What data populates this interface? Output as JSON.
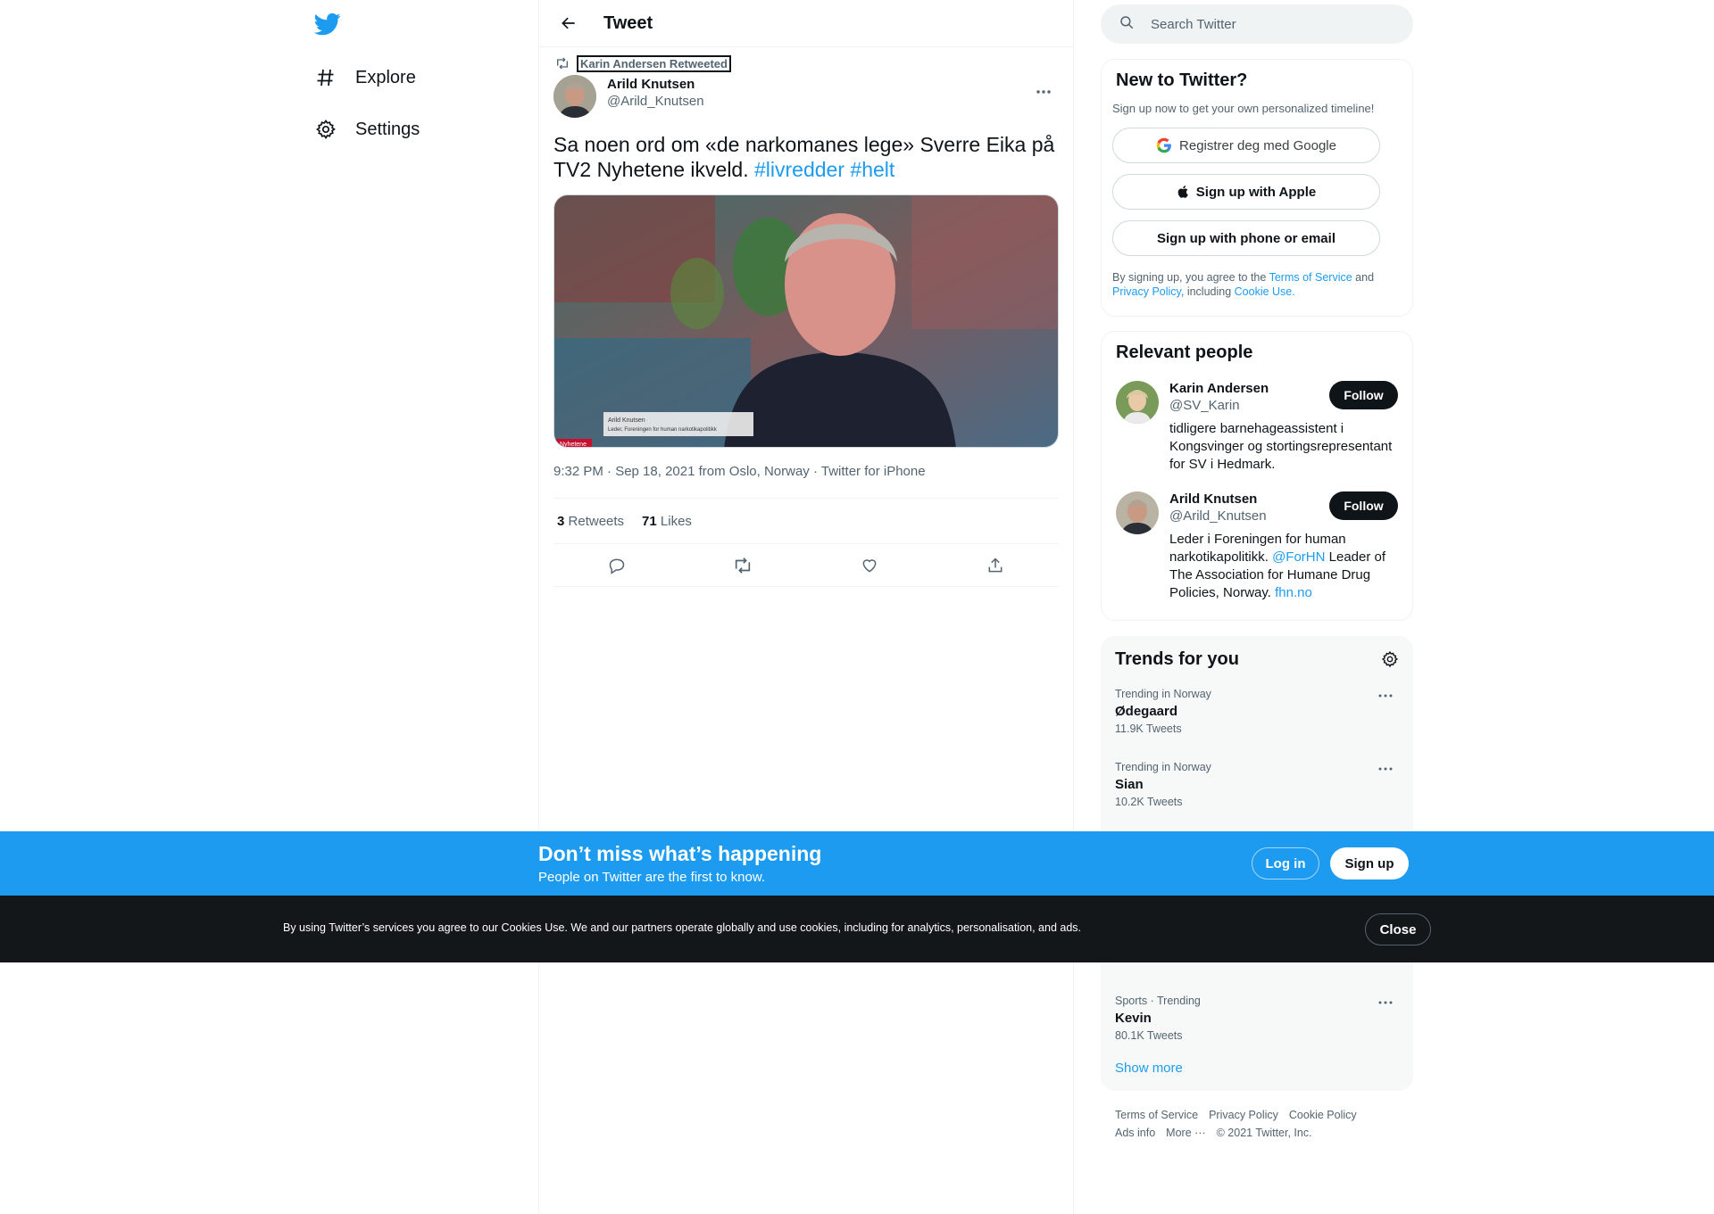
{
  "nav": {
    "logo": "twitter-bird-icon",
    "items": [
      {
        "label": "Explore",
        "icon": "hashtag-icon"
      },
      {
        "label": "Settings",
        "icon": "gear-icon"
      }
    ]
  },
  "header": {
    "title": "Tweet"
  },
  "tweet": {
    "retweeted_by": "Karin Andersen Retweeted",
    "author_name": "Arild Knutsen",
    "author_handle": "@Arild_Knutsen",
    "text_main": "Sa noen ord om «de narkomanes lege» Sverre Eika på TV2 Nyhetene ikveld. ",
    "hashtag1": "#livredder",
    "hashtag2": "#helt",
    "media_caption_name": "Arild Knutsen",
    "media_caption_title": "Leder, Foreningen for human narkotikapolitikk",
    "media_logo": "Nyhetene",
    "meta": "9:32 PM · Sep 18, 2021 from Oslo, Norway · Twitter for iPhone",
    "retweets_count": "3",
    "retweets_label": "Retweets",
    "likes_count": "71",
    "likes_label": "Likes"
  },
  "search": {
    "placeholder": "Search Twitter"
  },
  "new_to_twitter": {
    "title": "New to Twitter?",
    "subtitle": "Sign up now to get your own personalized timeline!",
    "google_label": "Registrer deg med Google",
    "apple_label": "Sign up with Apple",
    "phone_label": "Sign up with phone or email",
    "terms_prefix": "By signing up, you agree to the ",
    "terms_link": "Terms of Service",
    "terms_and": " and ",
    "privacy_link": "Privacy Policy",
    "terms_including": ", including ",
    "cookie_link": "Cookie Use."
  },
  "relevant_people": {
    "title": "Relevant people",
    "people": [
      {
        "name": "Karin Andersen",
        "handle": "@SV_Karin",
        "bio": "tidligere barnehageassistent i Kongsvinger og stortingsrepresentant for SV i Hedmark.",
        "follow": "Follow"
      },
      {
        "name": "Arild Knutsen",
        "handle": "@Arild_Knutsen",
        "bio_a": "Leder i Foreningen for human narkotikapolitikk. ",
        "bio_link1": "@ForHN",
        "bio_b": " Leader of The Association for Humane Drug Policies, Norway. ",
        "bio_link2": "fhn.no",
        "follow": "Follow"
      }
    ]
  },
  "trends": {
    "title": "Trends for you",
    "items": [
      {
        "context": "Trending in Norway",
        "name": "Ødegaard",
        "count": "11.9K Tweets"
      },
      {
        "context": "Trending in Norway",
        "name": "Sian",
        "count": "10.2K Tweets"
      },
      {
        "context": "Sports · Trending",
        "name": "Kevin",
        "count": "80.1K Tweets"
      }
    ],
    "show_more": "Show more"
  },
  "footer": {
    "links": [
      "Terms of Service",
      "Privacy Policy",
      "Cookie Policy",
      "Ads info",
      "More ···"
    ],
    "copyright": "© 2021 Twitter, Inc."
  },
  "banner": {
    "title": "Don’t miss what’s happening",
    "subtitle": "People on Twitter are the first to know.",
    "login": "Log in",
    "signup": "Sign up"
  },
  "cookie": {
    "text": "By using Twitter’s services you agree to our Cookies Use. We and our partners operate globally and use cookies, including for analytics, personalisation, and ads.",
    "close": "Close"
  },
  "colors": {
    "accent": "#1d9bf0",
    "text": "#0f1419",
    "muted": "#536471",
    "banner": "#1d9bf0",
    "cookie_bg": "#14171a"
  }
}
